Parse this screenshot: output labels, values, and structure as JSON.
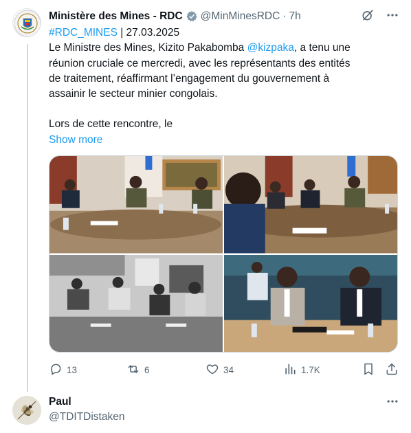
{
  "tweet": {
    "author_name": "Ministère des Mines - RDC",
    "handle": "@MinMinesRDC",
    "separator": "·",
    "time": "7h",
    "text_lines": [
      {
        "hashtag": "#RDC_MINES",
        "rest": " | 27.03.2025"
      },
      {
        "before": "Le Ministre des Mines, Kizito Pakabomba ",
        "mention": "@kizpaka",
        "after": ", a tenu une"
      },
      "réunion cruciale ce mercredi, avec les représentants des entités",
      "de traitement, réaffirmant l’engagement du gouvernement à",
      "assainir le secteur minier congolais.",
      "Lors de cette rencontre, le"
    ],
    "show_more": "Show more"
  },
  "actions": {
    "replies": "13",
    "retweets": "6",
    "likes": "34",
    "views": "1.7K"
  },
  "reply": {
    "author_name": "Paul",
    "handle": "@TDITDistaken"
  },
  "icons": {
    "verified": "verified-badge-icon",
    "grok": "grok-icon",
    "more": "more-icon",
    "reply": "reply-icon",
    "retweet": "retweet-icon",
    "like": "heart-icon",
    "views": "views-icon",
    "bookmark": "bookmark-icon",
    "share": "share-icon"
  },
  "colors": {
    "link": "#1d9bf0",
    "secondary_text": "#536471",
    "thread_line": "#cfd9de"
  }
}
